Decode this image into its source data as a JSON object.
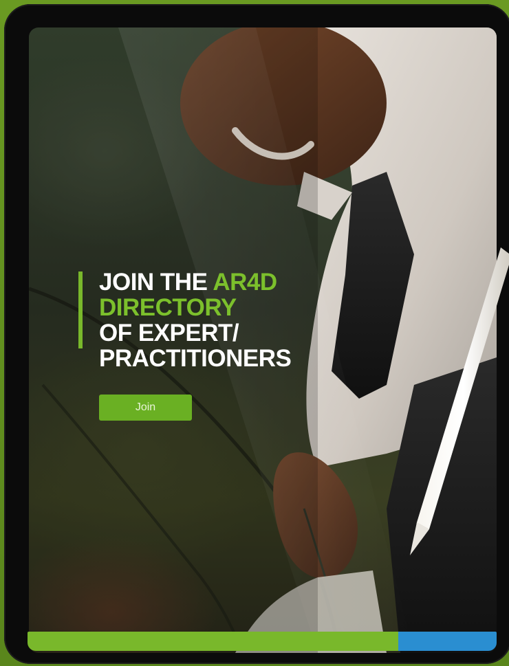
{
  "banner": {
    "headline_line1_prefix": "JOIN THE ",
    "headline_line1_accent": "AR4D",
    "headline_line2_accent": "DIRECTORY",
    "headline_line3": "OF EXPERT/",
    "headline_line4": "PRACTITIONERS",
    "join_label": "Join"
  },
  "progress": {
    "fraction_complete": 0.79,
    "fill_color": "#79b82b",
    "track_color": "#2a8ed1"
  },
  "colors": {
    "accent": "#7cc02c",
    "button": "#6ab023",
    "background": "#5c8a1e",
    "tablet_frame": "#0b0b0b"
  },
  "icons": {
    "stylus": "stylus-icon"
  }
}
